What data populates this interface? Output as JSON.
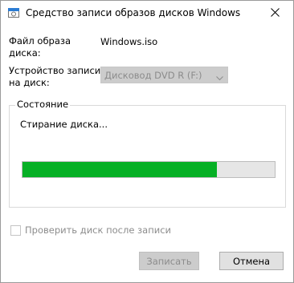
{
  "window": {
    "title": "Средство записи образов дисков Windows",
    "close_icon": "close-icon",
    "app_icon": "disc-burner-icon"
  },
  "image_file": {
    "label_line1": "Файл образа",
    "label_line2": "диска:",
    "value": "Windows.iso"
  },
  "device": {
    "label_line1": "Устройство записи",
    "label_line2": "на диск:",
    "selected": "Дисковод DVD R (F:)"
  },
  "status_group": {
    "title": "Состояние",
    "status_text": "Стирание диска...",
    "progress_fraction": 0.77,
    "progress_color": "#06b025"
  },
  "verify": {
    "label": "Проверить диск после записи",
    "checked": false
  },
  "buttons": {
    "burn_label": "Записать",
    "cancel_label": "Отмена"
  }
}
